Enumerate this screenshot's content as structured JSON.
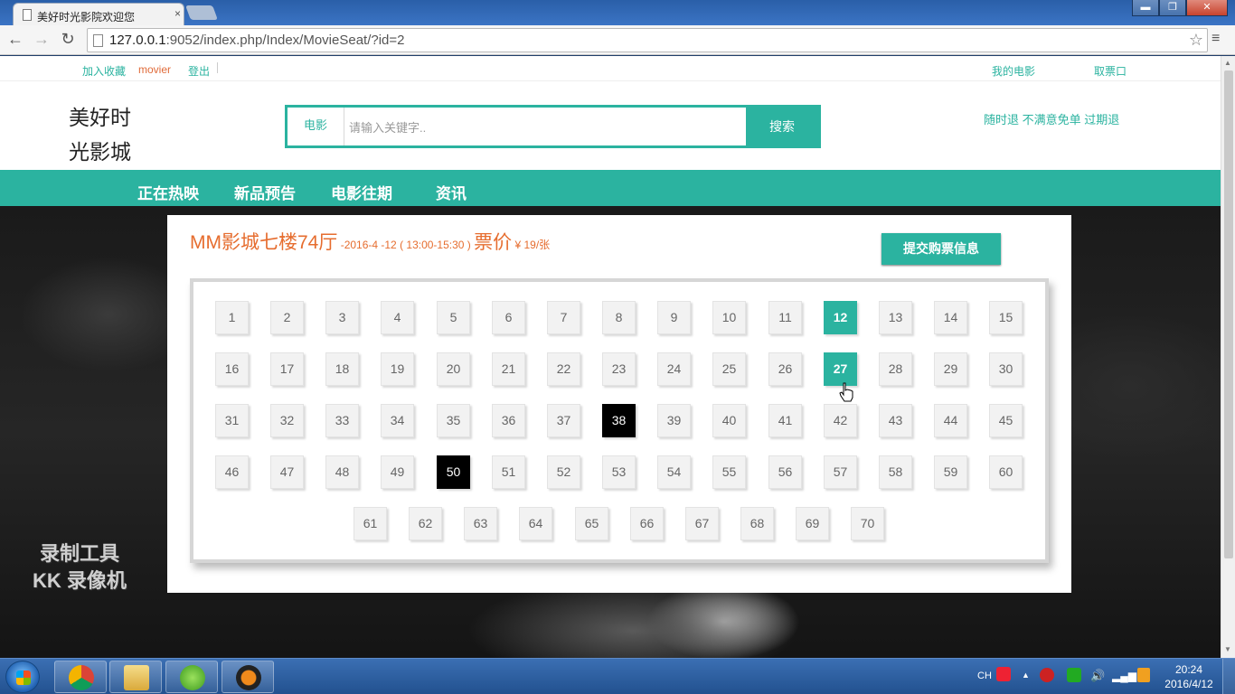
{
  "browser": {
    "tab_title": "美好时光影院欢迎您",
    "tab_close": "×",
    "url_host": "127.0.0.1",
    "url_rest": ":9052/index.php/Index/MovieSeat/?id=2",
    "back": "←",
    "forward": "→",
    "reload": "↻",
    "star": "☆",
    "menu": "≡",
    "min": "▬",
    "max": "❐",
    "close": "✕"
  },
  "topnav": {
    "favorite": "加入收藏",
    "user": "movier",
    "logout": "登出",
    "my_movies": "我的电影",
    "pickup": "取票口"
  },
  "header": {
    "logo_line1": "美好时",
    "logo_line2": "光影城",
    "search_category": "电影",
    "search_placeholder": "请输入关键字..",
    "search_button": "搜索",
    "slogan": "随时退 不满意免单 过期退"
  },
  "mainnav": {
    "items": [
      "正在热映",
      "新品预告",
      "电影往期",
      "资讯"
    ]
  },
  "watermark": {
    "line1": "录制工具",
    "line2": "KK 录像机"
  },
  "booking": {
    "hall": "MM影城七楼74厅",
    "time": " -2016-4 -12 ( 13:00-15:30 ) ",
    "price_label": "票价",
    "price": " ¥ 19/张",
    "submit": "提交购票信息",
    "seats": [
      "1",
      "2",
      "3",
      "4",
      "5",
      "6",
      "7",
      "8",
      "9",
      "10",
      "11",
      "12",
      "13",
      "14",
      "15",
      "16",
      "17",
      "18",
      "19",
      "20",
      "21",
      "22",
      "23",
      "24",
      "25",
      "26",
      "27",
      "28",
      "29",
      "30",
      "31",
      "32",
      "33",
      "34",
      "35",
      "36",
      "37",
      "38",
      "39",
      "40",
      "41",
      "42",
      "43",
      "44",
      "45",
      "46",
      "47",
      "48",
      "49",
      "50",
      "51",
      "52",
      "53",
      "54",
      "55",
      "56",
      "57",
      "58",
      "59",
      "60",
      "61",
      "62",
      "63",
      "64",
      "65",
      "66",
      "67",
      "68",
      "69",
      "70"
    ],
    "selected_seats": [
      "12",
      "27"
    ],
    "sold_seats": [
      "38",
      "50"
    ]
  },
  "taskbar": {
    "lang": "CH",
    "time": "20:24",
    "date": "2016/4/12"
  },
  "colors": {
    "accent": "#2bb3a0",
    "title_orange": "#e66d2f",
    "sold": "#000000"
  }
}
